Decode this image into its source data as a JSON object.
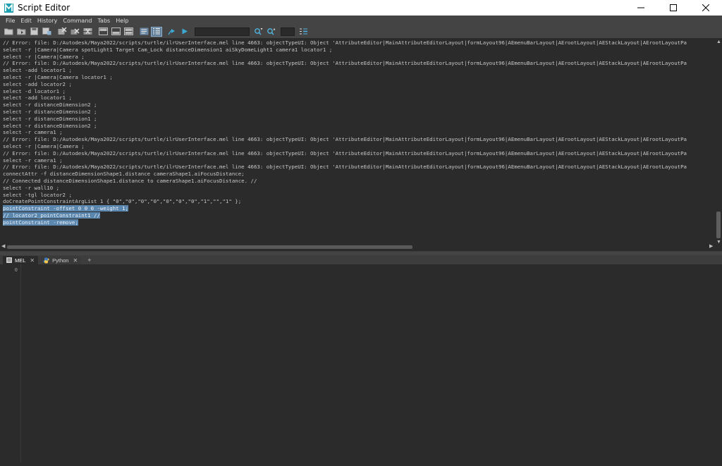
{
  "window": {
    "title": "Script Editor",
    "controls": [
      "minimize",
      "maximize",
      "close"
    ]
  },
  "menu": [
    "File",
    "Edit",
    "History",
    "Command",
    "Tabs",
    "Help"
  ],
  "history": {
    "lines": [
      "// Error: file: D:/Autodesk/Maya2022/scripts/turtle/ilrUserInterface.mel line 4663: objectTypeUI: Object 'AttributeEditor|MainAttributeEditorLayout|formLayout96|AEmenuBarLayout|AErootLayout|AEStackLayout|AErootLayoutPa",
      "select -r |Camera|Camera spotLight1 Target Cam_Lock distanceDimension1 aiSkyDomeLight1 camera1 locator1 ;",
      "select -r |Camera|Camera ;",
      "// Error: file: D:/Autodesk/Maya2022/scripts/turtle/ilrUserInterface.mel line 4663: objectTypeUI: Object 'AttributeEditor|MainAttributeEditorLayout|formLayout96|AEmenuBarLayout|AErootLayout|AEStackLayout|AErootLayoutPa",
      "select -add locator1 ;",
      "select -r |Camera|Camera locator1 ;",
      "select -add locator2 ;",
      "select -d locator1 ;",
      "select -add locator1 ;",
      "select -r distanceDimension2 ;",
      "select -r distanceDimension2 ;",
      "select -r distanceDimension1 ;",
      "select -r distanceDimension2 ;",
      "select -r camera1 ;",
      "// Error: file: D:/Autodesk/Maya2022/scripts/turtle/ilrUserInterface.mel line 4663: objectTypeUI: Object 'AttributeEditor|MainAttributeEditorLayout|formLayout96|AEmenuBarLayout|AErootLayout|AEStackLayout|AErootLayoutPa",
      "select -r |Camera|Camera ;",
      "// Error: file: D:/Autodesk/Maya2022/scripts/turtle/ilrUserInterface.mel line 4663: objectTypeUI: Object 'AttributeEditor|MainAttributeEditorLayout|formLayout96|AEmenuBarLayout|AErootLayout|AEStackLayout|AErootLayoutPa",
      "select -r camera1 ;",
      "// Error: file: D:/Autodesk/Maya2022/scripts/turtle/ilrUserInterface.mel line 4663: objectTypeUI: Object 'AttributeEditor|MainAttributeEditorLayout|formLayout96|AEmenuBarLayout|AErootLayout|AEStackLayout|AErootLayoutPa",
      "connectAttr -f distanceDimensionShape1.distance cameraShape1.aiFocusDistance;",
      "// Connected distanceDimensionShape1.distance to cameraShape1.aiFocusDistance. //",
      "select -r wall10 ;",
      "select -tgl locator2 ;",
      "doCreatePointConstraintArgList 1 { \"0\",\"0\",\"0\",\"0\",\"0\",\"0\",\"0\",\"1\",\"\",\"1\" };"
    ],
    "selected_lines": [
      "pointConstraint -offset 0 0 0 -weight 1;",
      "// locator2_pointConstraint1 //",
      "pointConstraint -remove;"
    ]
  },
  "tabs": [
    {
      "label": "MEL",
      "icon": "mel-icon"
    },
    {
      "label": "Python",
      "icon": "python-icon"
    }
  ],
  "tab_add_label": "+",
  "input": {
    "line_number": "0",
    "value": ""
  },
  "colors": {
    "background": "#444444",
    "pane": "#2b2b2b",
    "selection": "#5b86ad",
    "title_bar": "#ffffff",
    "maya_accent": "#1fa0b0"
  }
}
